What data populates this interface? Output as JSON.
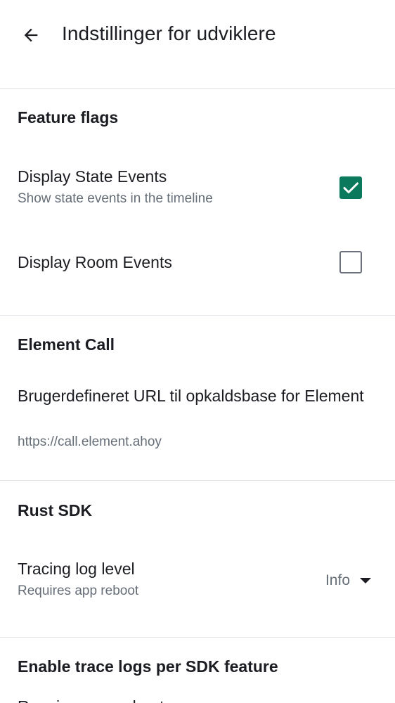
{
  "header": {
    "title": "Indstillinger for udviklere",
    "back_icon": "arrow-left-icon"
  },
  "feature_flags": {
    "section_title": "Feature flags",
    "items": [
      {
        "title": "Display State Events",
        "subtitle": "Show state events in the timeline",
        "checked": true
      },
      {
        "title": "Display Room Events",
        "checked": false
      }
    ]
  },
  "element_call": {
    "section_title": "Element Call",
    "url_title": "Brugerdefineret URL til opkaldsbase for Element",
    "url_value": "https://call.element.ahoy"
  },
  "rust_sdk": {
    "section_title": "Rust SDK",
    "tracing_title": "Tracing log level",
    "tracing_subtitle": "Requires app reboot",
    "tracing_value": "Info"
  },
  "trace_logs": {
    "section_title": "Enable trace logs per SDK feature",
    "partial_item": "Requires app reboot"
  },
  "colors": {
    "accent": "#0b7a5c",
    "divider": "#e3e5ea",
    "secondary_text": "#656d77"
  }
}
